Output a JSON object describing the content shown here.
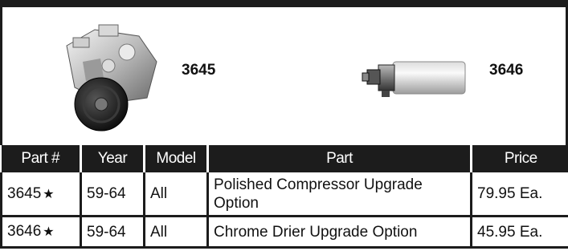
{
  "products": [
    {
      "label": "3645",
      "image": "compressor"
    },
    {
      "label": "3646",
      "image": "drier"
    }
  ],
  "table": {
    "headers": [
      "Part #",
      "Year",
      "Model",
      "Part",
      "Price"
    ],
    "rows": [
      {
        "part_no": "3645",
        "star": "★",
        "year": "59-64",
        "model": "All",
        "part": "Polished Compressor Upgrade Option",
        "price": "79.95 Ea."
      },
      {
        "part_no": "3646",
        "star": "★",
        "year": "59-64",
        "model": "All",
        "part": "Chrome Drier Upgrade Option",
        "price": "45.95 Ea."
      }
    ]
  }
}
